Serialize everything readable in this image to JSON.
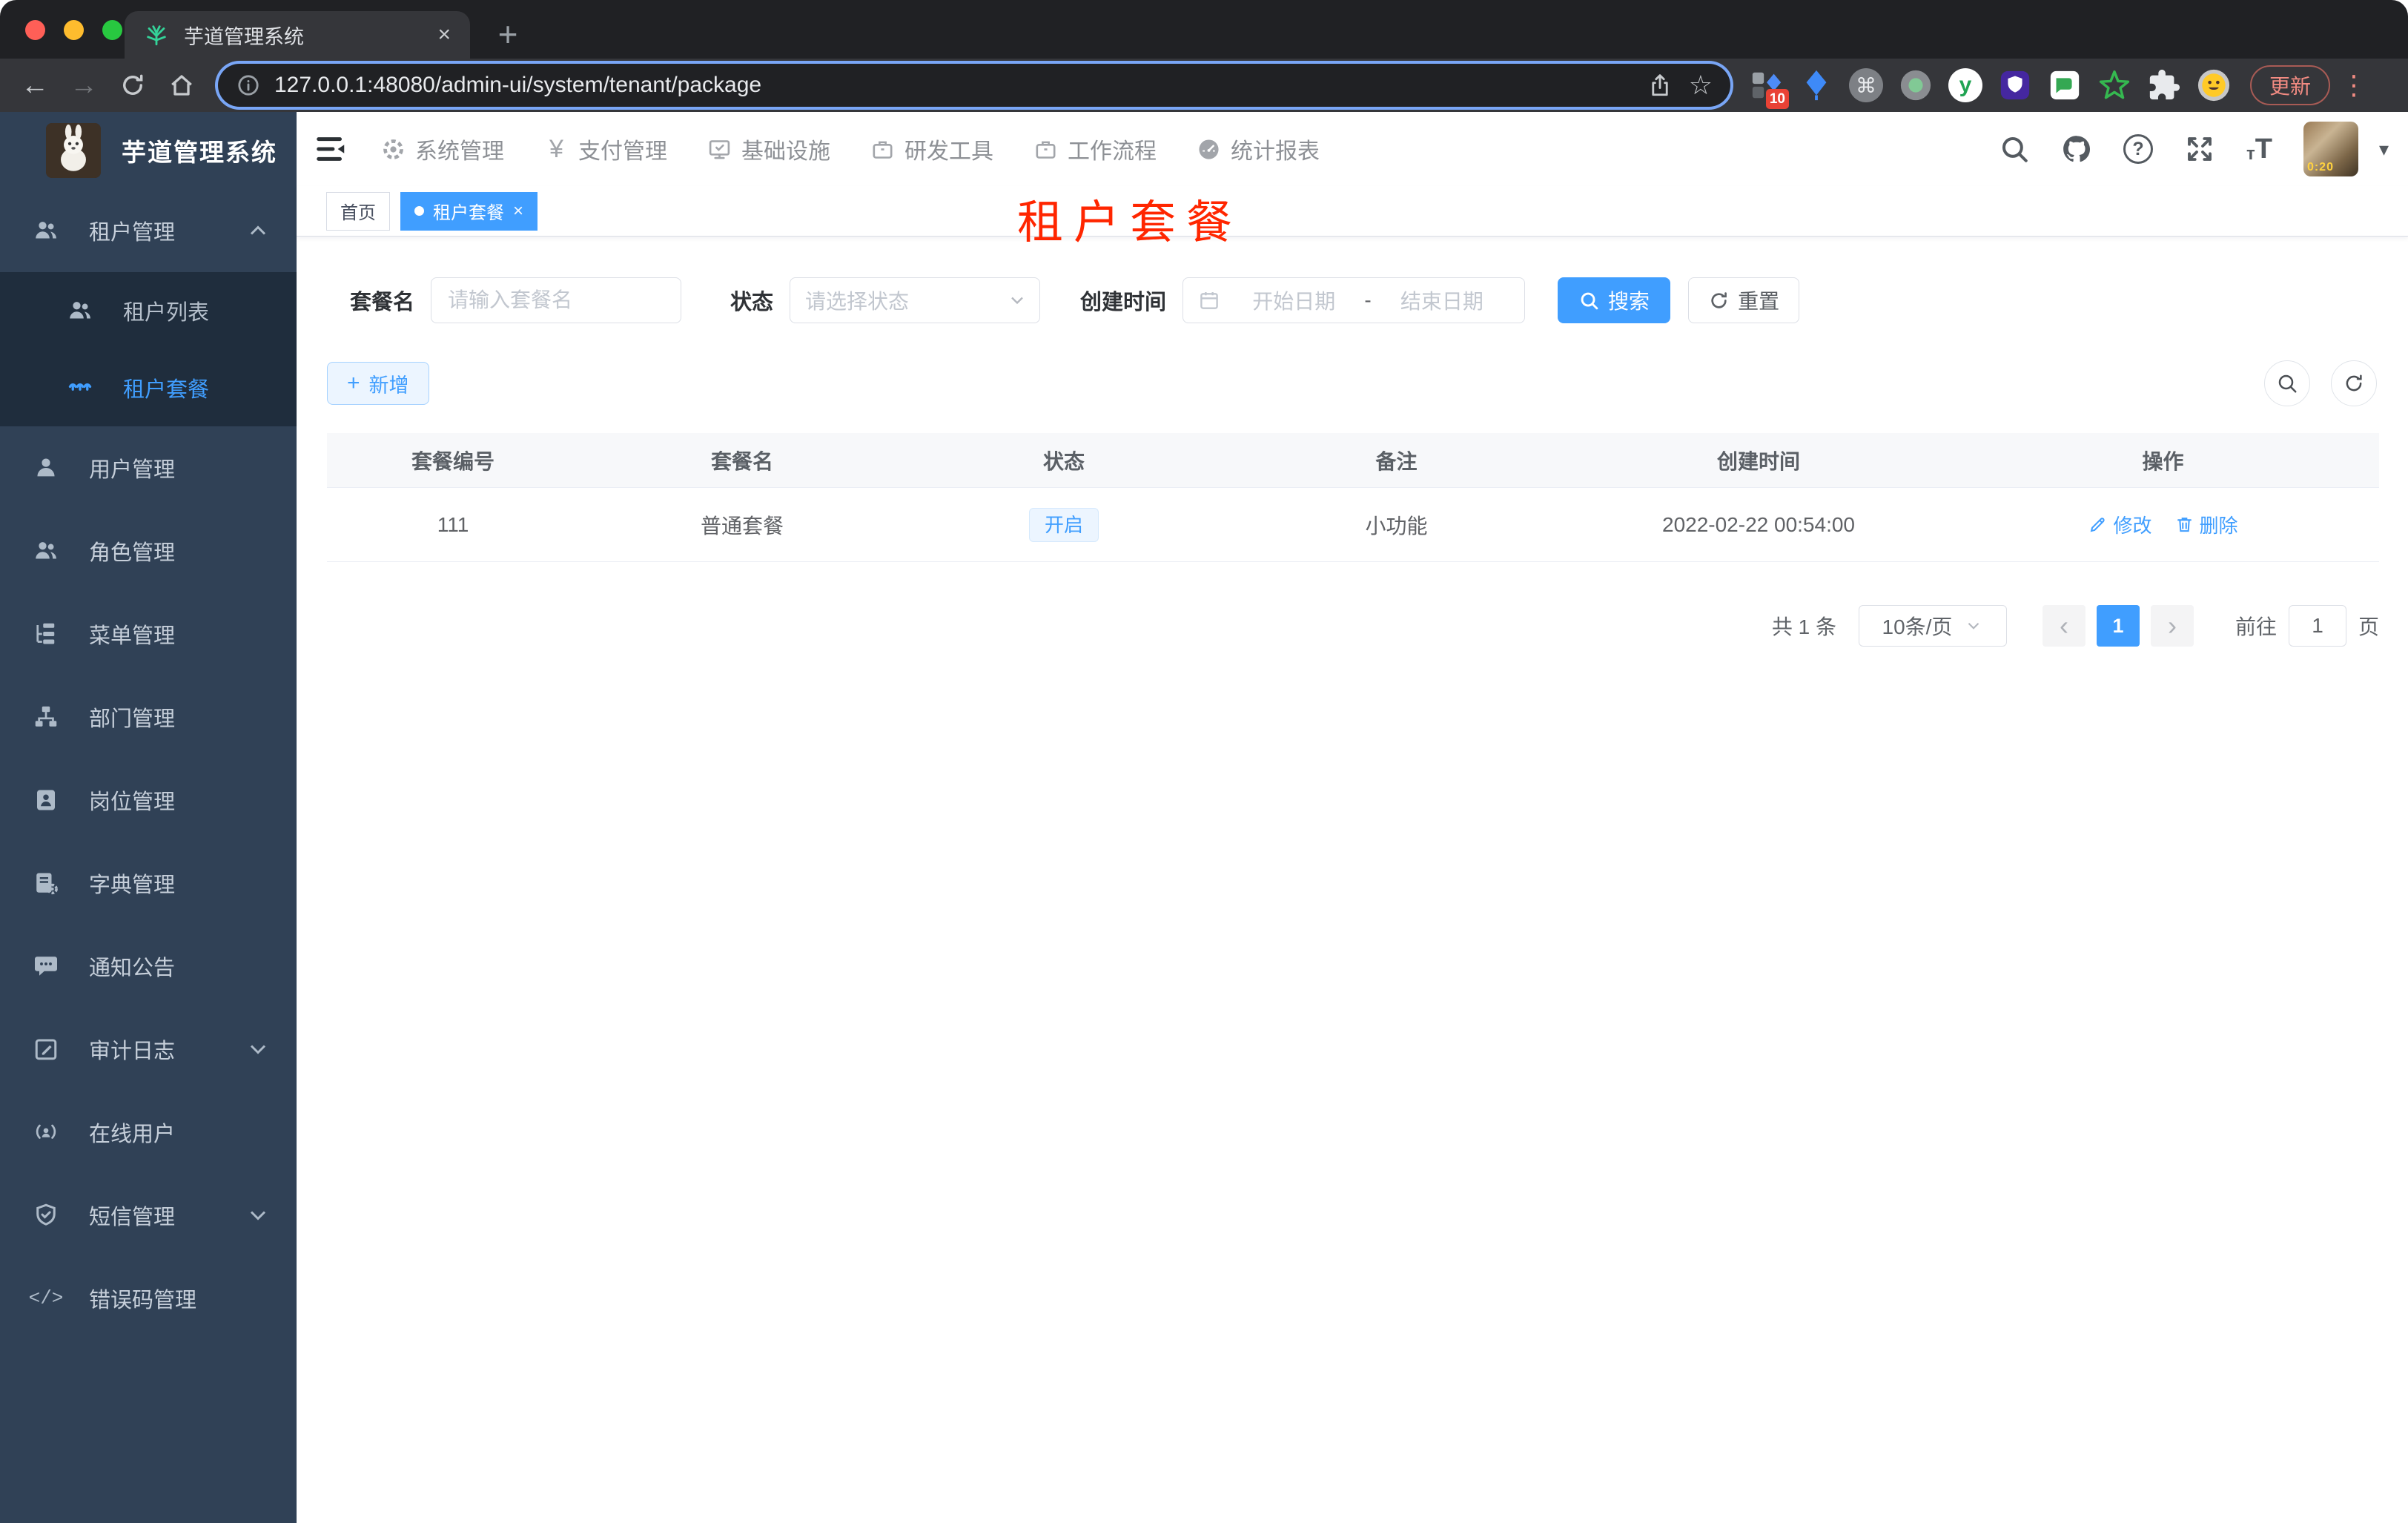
{
  "browser": {
    "tab_title": "芋道管理系统",
    "url": "127.0.0.1:48080/admin-ui/system/tenant/package",
    "update_label": "更新",
    "extension_badge": "10",
    "avatar_time": "0:20"
  },
  "glyphs": {
    "close": "×",
    "new_tab": "+",
    "back": "←",
    "forward": "→",
    "star": "☆",
    "menu_dots": "⋮",
    "cmd": "⌘",
    "yen": "¥",
    "question": "?",
    "code": "</>",
    "prev": "‹",
    "next": "›",
    "t_big": "T",
    "t_small": "т",
    "y": "y",
    "tag_close": "×",
    "plus": "+",
    "caret_down": "▾"
  },
  "app": {
    "logo_title": "芋道管理系统",
    "top_nav": [
      "系统管理",
      "支付管理",
      "基础设施",
      "研发工具",
      "工作流程",
      "统计报表"
    ],
    "sidebar": {
      "tenant_group": "租户管理",
      "tenant_list": "租户列表",
      "tenant_package": "租户套餐",
      "items": [
        "用户管理",
        "角色管理",
        "菜单管理",
        "部门管理",
        "岗位管理",
        "字典管理",
        "通知公告",
        "审计日志",
        "在线用户",
        "短信管理",
        "错误码管理"
      ]
    },
    "tags": {
      "home": "首页",
      "active": "租户套餐"
    },
    "overlay_title": "租户套餐",
    "filters": {
      "name_label": "套餐名",
      "name_placeholder": "请输入套餐名",
      "status_label": "状态",
      "status_placeholder": "请选择状态",
      "created_label": "创建时间",
      "start_placeholder": "开始日期",
      "separator": "-",
      "end_placeholder": "结束日期",
      "search_label": "搜索",
      "reset_label": "重置"
    },
    "toolbar": {
      "add_label": "新增"
    },
    "table": {
      "headers": [
        "套餐编号",
        "套餐名",
        "状态",
        "备注",
        "创建时间",
        "操作"
      ],
      "rows": [
        {
          "id": "111",
          "name": "普通套餐",
          "status": "开启",
          "remark": "小功能",
          "created": "2022-02-22 00:54:00",
          "edit_label": "修改",
          "delete_label": "删除"
        }
      ]
    },
    "pagination": {
      "total": "共 1 条",
      "page_size": "10条/页",
      "current_page": "1",
      "goto_label": "前往",
      "goto_value": "1",
      "unit_label": "页"
    }
  },
  "colors": {
    "accent": "#409eff",
    "sidebar_bg": "#304156",
    "submenu_bg": "#1f2d3d",
    "overlay_red": "#ff2600"
  }
}
